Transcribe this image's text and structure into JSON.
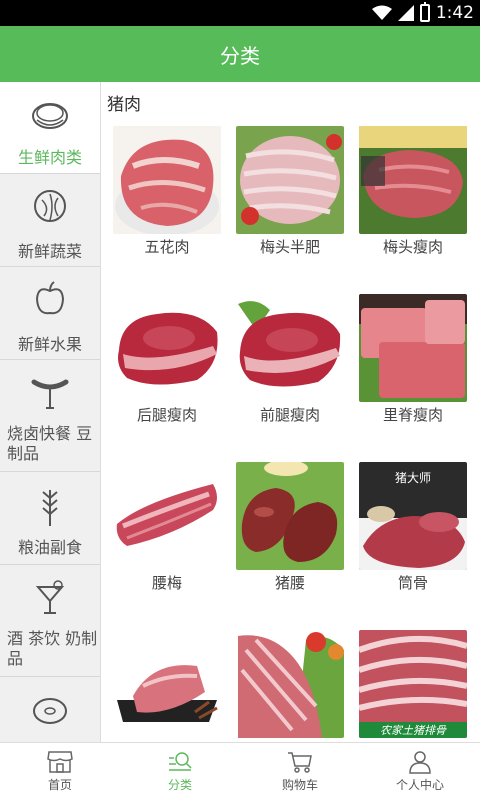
{
  "status_bar": {
    "time": "1:42"
  },
  "header": {
    "title": "分类"
  },
  "sidebar": {
    "items": [
      {
        "label": "生鲜肉类",
        "icon": "steak-icon",
        "active": true
      },
      {
        "label": "新鲜蔬菜",
        "icon": "cabbage-icon",
        "active": false
      },
      {
        "label": "新鲜水果",
        "icon": "apple-icon",
        "active": false
      },
      {
        "label": "烧卤快餐 豆制品",
        "icon": "sausage-icon",
        "active": false
      },
      {
        "label": "粮油副食",
        "icon": "wheat-icon",
        "active": false
      },
      {
        "label": "酒 茶饮 奶制品",
        "icon": "cocktail-icon",
        "active": false
      },
      {
        "label": "",
        "icon": "donut-icon",
        "active": false
      }
    ]
  },
  "content": {
    "section_title": "猪肉",
    "products": [
      {
        "name": "五花肉"
      },
      {
        "name": "梅头半肥"
      },
      {
        "name": "梅头瘦肉"
      },
      {
        "name": "后腿瘦肉"
      },
      {
        "name": "前腿瘦肉"
      },
      {
        "name": "里脊瘦肉"
      },
      {
        "name": "腰梅"
      },
      {
        "name": "猪腰"
      },
      {
        "name": "筒骨"
      },
      {
        "name": ""
      },
      {
        "name": ""
      },
      {
        "name": ""
      }
    ],
    "image_texts": {
      "p9": "猪大师",
      "p12": "农家土猪排骨"
    }
  },
  "tabbar": {
    "items": [
      {
        "label": "首页",
        "icon": "store-icon",
        "active": false
      },
      {
        "label": "分类",
        "icon": "search-list-icon",
        "active": true
      },
      {
        "label": "购物车",
        "icon": "cart-icon",
        "active": false
      },
      {
        "label": "个人中心",
        "icon": "user-icon",
        "active": false
      }
    ]
  },
  "colors": {
    "accent": "#5cb85c",
    "status_bar": "#000000"
  }
}
